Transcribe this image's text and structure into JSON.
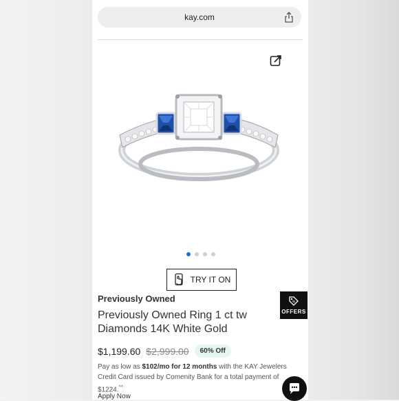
{
  "browser": {
    "url": "kay.com",
    "share_icon": "share-icon"
  },
  "gallery": {
    "share_icon": "share-out-icon",
    "image_alt": "Sapphire and diamond three-stone ring",
    "dots": [
      {
        "active": true
      },
      {
        "active": false
      },
      {
        "active": false
      },
      {
        "active": false
      }
    ]
  },
  "try_on": {
    "label": "TRY IT ON",
    "icon": "phone-hand-icon"
  },
  "product": {
    "condition": "Previously Owned",
    "title": "Previously Owned Ring 1 ct tw Diamonds 14K White Gold",
    "price": "$1,199.60",
    "original_price": "$2,999.00",
    "discount": "60% Off"
  },
  "financing": {
    "text_prefix": "Pay as low as ",
    "amount": "$102/mo for 12 months",
    "text_suffix": " with the KAY Jewelers Credit Card issued by Comenity Bank for a total payment of $1224.",
    "footnote": "^^",
    "apply_label": "Apply Now"
  },
  "offers": {
    "label": "OFFERS",
    "icon": "tag-icon"
  },
  "chat": {
    "icon": "chat-icon"
  },
  "colors": {
    "accent_blue": "#1a6fd4",
    "discount_bg": "#e6f6f2",
    "dark": "#111111"
  }
}
